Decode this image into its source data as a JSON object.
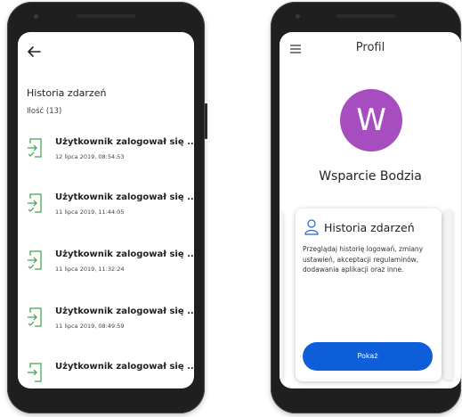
{
  "left_screen": {
    "title": "Historia zdarzeń",
    "count": "Ilość (13)",
    "events": [
      {
        "label": "Użytkownik zalogował się ...",
        "date": "12 lipca 2019, 08:54:53"
      },
      {
        "label": "Użytkownik zalogował się ...",
        "date": "11 lipca 2019, 11:44:05"
      },
      {
        "label": "Użytkownik zalogował się ...",
        "date": "11 lipca 2019, 11:32:24"
      },
      {
        "label": "Użytkownik zalogował się ...",
        "date": "11 lipca 2019, 08:49:59"
      },
      {
        "label": "Użytkownik zalogował się ...",
        "date": ""
      }
    ],
    "icons": {
      "back": "arrow-left-icon",
      "event": "login-check-icon"
    }
  },
  "right_screen": {
    "title": "Profil",
    "avatar_letter": "W",
    "user_name": "Wsparcie Bodzia",
    "card": {
      "title": "Historia zdarzeń",
      "description": "Przeglądaj historię logowań, zmiany ustawień, akceptacji regulaminów, dodawania aplikacji oraz inne.",
      "button_label": "Pokaż"
    },
    "icons": {
      "menu": "hamburger-menu-icon",
      "card": "person-icon"
    }
  },
  "colors": {
    "avatar": "#a64dbf",
    "button": "#0d5ed8",
    "event_icon": "#3fa34d"
  }
}
